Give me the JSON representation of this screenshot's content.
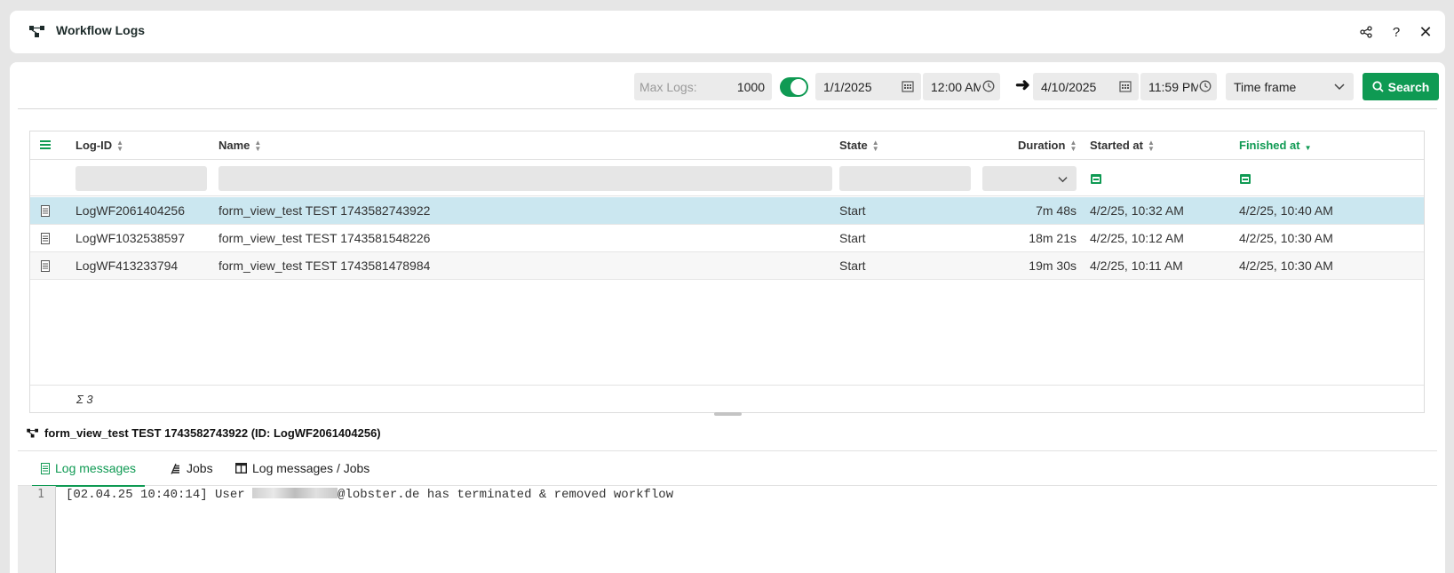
{
  "window": {
    "title": "Workflow Logs"
  },
  "toolbar": {
    "max_logs_label": "Max Logs:",
    "max_logs_value": "1000",
    "toggle_on": true,
    "from_date": "1/1/2025",
    "from_time": "12:00 AM",
    "to_date": "4/10/2025",
    "to_time": "11:59 PM",
    "timeframe": "Time frame",
    "search_label": "Search"
  },
  "table": {
    "columns": {
      "log_id": "Log-ID",
      "name": "Name",
      "state": "State",
      "duration": "Duration",
      "started": "Started at",
      "finished": "Finished at"
    },
    "rows": [
      {
        "log_id": "LogWF2061404256",
        "name": "form_view_test TEST 1743582743922",
        "state": "Start",
        "duration": "7m 48s",
        "started": "4/2/25, 10:32 AM",
        "finished": "4/2/25, 10:40 AM"
      },
      {
        "log_id": "LogWF1032538597",
        "name": "form_view_test TEST 1743581548226",
        "state": "Start",
        "duration": "18m 21s",
        "started": "4/2/25, 10:12 AM",
        "finished": "4/2/25, 10:30 AM"
      },
      {
        "log_id": "LogWF413233794",
        "name": "form_view_test TEST 1743581478984",
        "state": "Start",
        "duration": "19m 30s",
        "started": "4/2/25, 10:11 AM",
        "finished": "4/2/25, 10:30 AM"
      }
    ],
    "footer_sum": "Σ 3"
  },
  "detail": {
    "title": "form_view_test TEST 1743582743922 (ID: LogWF2061404256)",
    "tabs": [
      "Log messages",
      "Jobs",
      "Log messages / Jobs"
    ],
    "line_number": "1",
    "log_prefix": "[02.04.25 10:40:14] User ",
    "log_suffix": "@lobster.de has terminated & removed workflow"
  },
  "colors": {
    "accent": "#0f9a53",
    "selected_row": "#cbe7f0"
  }
}
